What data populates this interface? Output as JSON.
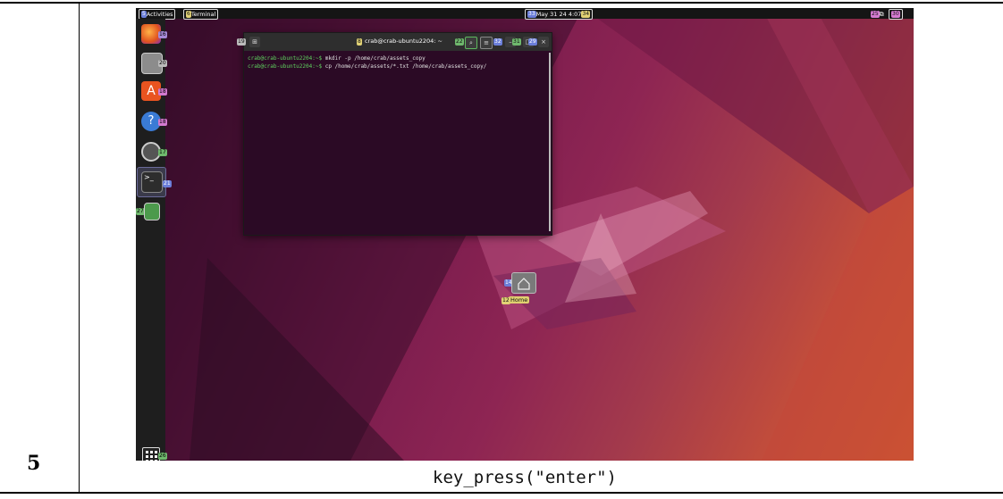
{
  "step_number": "5",
  "action_caption": "key_press(\"enter\")",
  "topbar": {
    "activities_badge": "5",
    "activities": "Activities",
    "app_badge": "6",
    "app_name": "Terminal",
    "clock_badge": "33",
    "date": "May 31",
    "time": "24 4:07",
    "time_badge": "34",
    "tray_badge": "25",
    "volume_badge": "30"
  },
  "dock": {
    "items": [
      {
        "name": "firefox",
        "badge": "16"
      },
      {
        "name": "files",
        "badge": "20"
      },
      {
        "name": "software",
        "badge": "18"
      },
      {
        "name": "help",
        "badge": "18"
      },
      {
        "name": "settings",
        "badge": "17"
      },
      {
        "name": "terminal",
        "badge": "21"
      },
      {
        "name": "trash",
        "badge": "27"
      }
    ],
    "apps_badge": "26"
  },
  "terminal": {
    "new_tab_badge": "19",
    "title_badge": "8",
    "title": "crab@crab-ubuntu2204: ~",
    "search_badge": "22",
    "search_inner_badge": "23",
    "menu_badge": "32",
    "minimize_badge": "31",
    "close_badge": "29",
    "lines": [
      {
        "prompt": "crab@crab-ubuntu2204:~$ ",
        "cmd": "mkdir -p /home/crab/assets_copy"
      },
      {
        "prompt": "crab@crab-ubuntu2204:~$ ",
        "cmd": "cp /home/crab/assets/*.txt /home/crab/assets_copy/"
      }
    ]
  },
  "desktop": {
    "home_badge": "14",
    "home_label_badge": "12",
    "home_label": "Home"
  }
}
